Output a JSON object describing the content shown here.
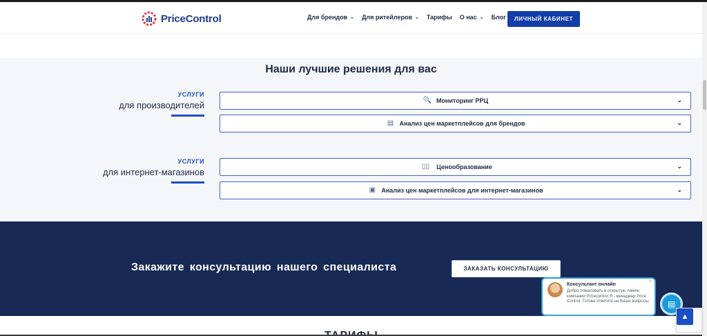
{
  "header": {
    "logo_text": "PriceControl",
    "nav": [
      {
        "label": "Для брендов",
        "has_dropdown": true
      },
      {
        "label": "Для ритейлеров",
        "has_dropdown": true
      },
      {
        "label": "Тарифы",
        "has_dropdown": false
      },
      {
        "label": "О нас",
        "has_dropdown": true
      },
      {
        "label": "Блог",
        "has_dropdown": false
      }
    ],
    "cabinet_label": "ЛИЧНЫЙ КАБИНЕТ"
  },
  "solutions": {
    "title": "Наши лучшие решения для вас",
    "groups": [
      {
        "kicker": "УСЛУГИ",
        "name": "для производителей",
        "items": [
          {
            "label": "Мониторинг РРЦ",
            "icon": "magnifier-icon"
          },
          {
            "label": "Анализ цен маркетплейсов для брендов",
            "icon": "document-search-icon"
          }
        ]
      },
      {
        "kicker": "УСЛУГИ",
        "name": "для интернет-магазинов",
        "items": [
          {
            "label": "Ценообразование",
            "icon": "price-tags-icon"
          },
          {
            "label": "Анализ цен маркетплейсов для интернет-магазинов",
            "icon": "store-analytics-icon"
          }
        ]
      }
    ]
  },
  "cta": {
    "text": "Закажите консультацию нашего специалиста",
    "button_label": "ЗАКАЗАТЬ КОНСУЛЬТАЦИЮ"
  },
  "next_section_title": "ТАРИФЫ",
  "chat": {
    "title": "Консультант онлайн",
    "message": "Добро пожаловать в открытую линию компании Pricecontrol.Я - менеджер Price Control. Готова ответить на Ваши вопросы.",
    "close_glyph": "×"
  },
  "colors": {
    "brand": "#123ea8",
    "dark_band": "#172954",
    "accent": "#1a4fc4",
    "chat": "#1a9be0"
  }
}
